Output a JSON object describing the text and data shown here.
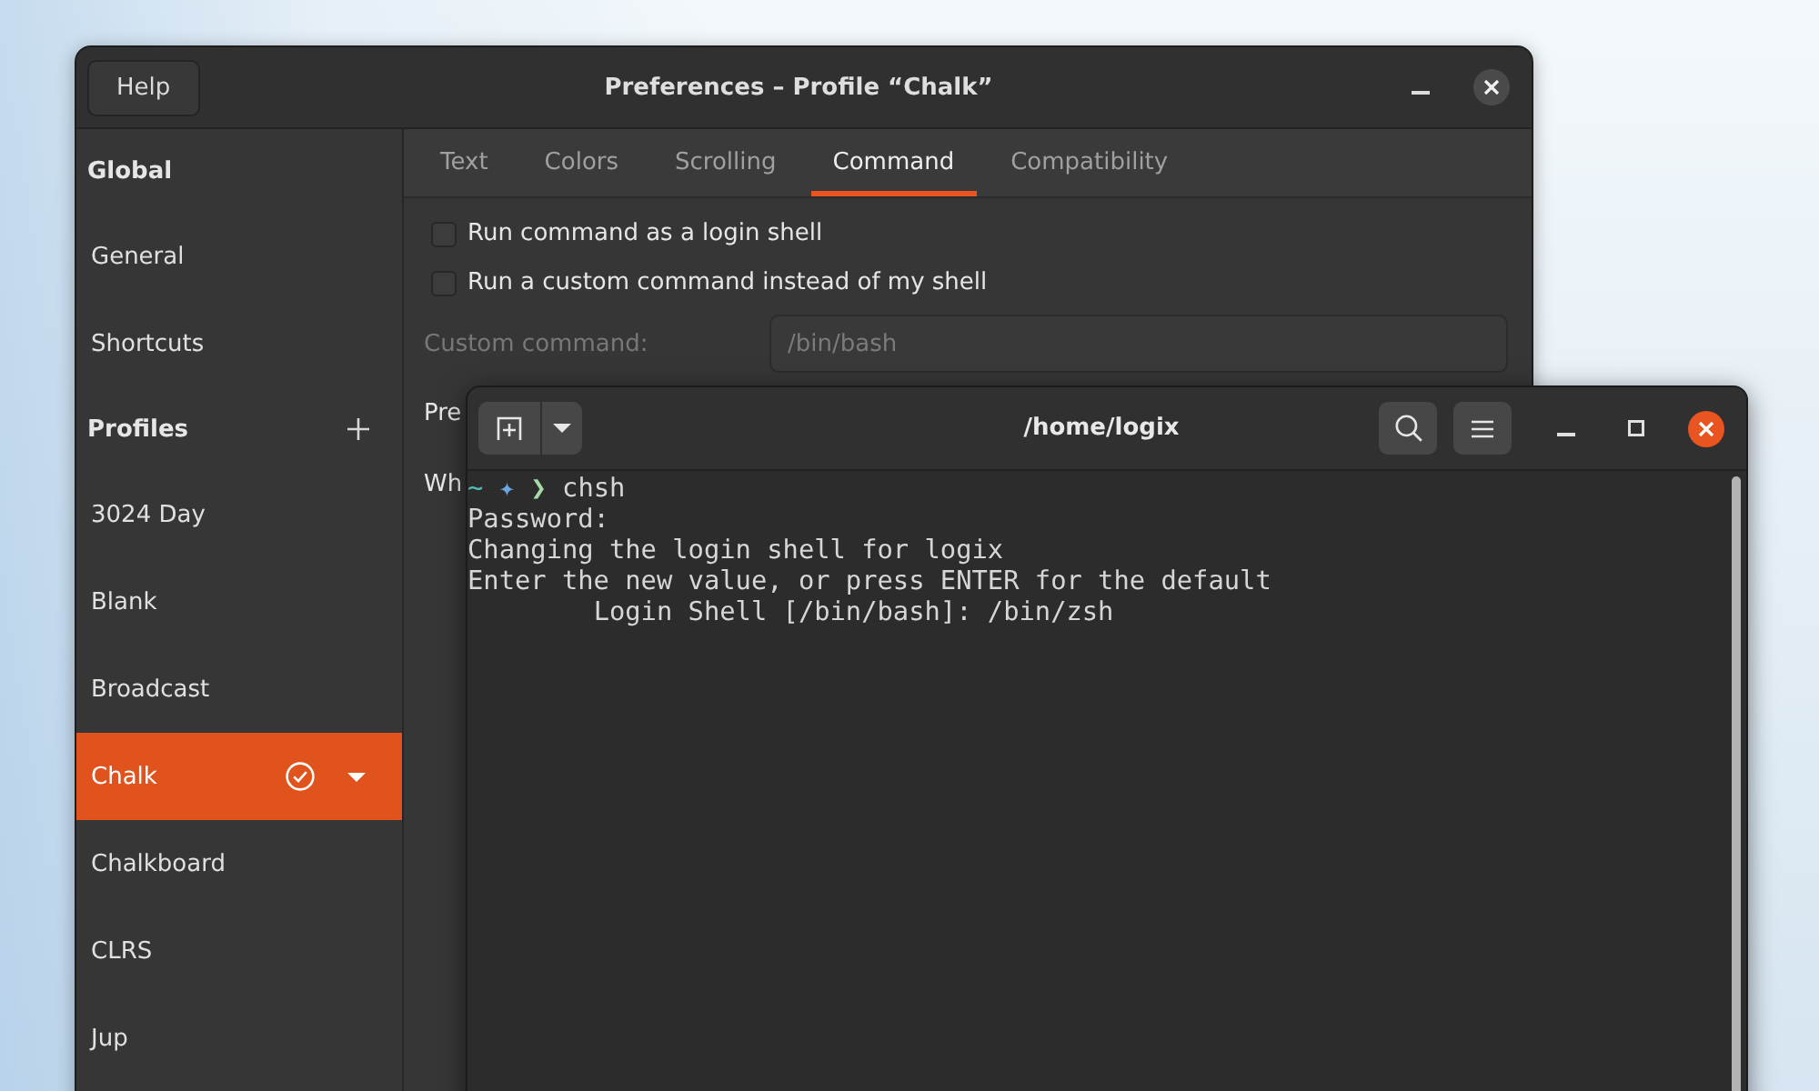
{
  "preferences": {
    "title": "Preferences – Profile “Chalk”",
    "help_button": "Help",
    "sidebar": {
      "sections": [
        {
          "heading": "Global",
          "addable": false,
          "items": [
            {
              "label": "General",
              "selected": false,
              "default": false
            },
            {
              "label": "Shortcuts",
              "selected": false,
              "default": false
            }
          ]
        },
        {
          "heading": "Profiles",
          "addable": true,
          "items": [
            {
              "label": "3024 Day",
              "selected": false,
              "default": false
            },
            {
              "label": "Blank",
              "selected": false,
              "default": false
            },
            {
              "label": "Broadcast",
              "selected": false,
              "default": false
            },
            {
              "label": "Chalk",
              "selected": true,
              "default": true
            },
            {
              "label": "Chalkboard",
              "selected": false,
              "default": false
            },
            {
              "label": "CLRS",
              "selected": false,
              "default": false
            },
            {
              "label": "Jup",
              "selected": false,
              "default": false
            }
          ]
        }
      ]
    },
    "tabs": [
      {
        "label": "Text",
        "selected": false
      },
      {
        "label": "Colors",
        "selected": false
      },
      {
        "label": "Scrolling",
        "selected": false
      },
      {
        "label": "Command",
        "selected": true
      },
      {
        "label": "Compatibility",
        "selected": false
      }
    ],
    "options": [
      {
        "label": "Run command as a login shell",
        "checked": false
      },
      {
        "label": "Run a custom command instead of my shell",
        "checked": false
      }
    ],
    "custom_command": {
      "label": "Custom command:",
      "value": "/bin/bash",
      "disabled": true
    },
    "covered_labels": [
      "Pre",
      "Wh"
    ]
  },
  "terminal": {
    "title": "/home/logix",
    "lines": [
      {
        "kind": "prompt",
        "cwd": "~",
        "symbol": "✦",
        "arrow": "❯",
        "command": "chsh"
      },
      {
        "kind": "output",
        "text": "Password:"
      },
      {
        "kind": "output",
        "text": "Changing the login shell for logix"
      },
      {
        "kind": "output",
        "text": "Enter the new value, or press ENTER for the default"
      },
      {
        "kind": "output",
        "text": "\tLogin Shell [/bin/bash]: /bin/zsh"
      }
    ]
  }
}
